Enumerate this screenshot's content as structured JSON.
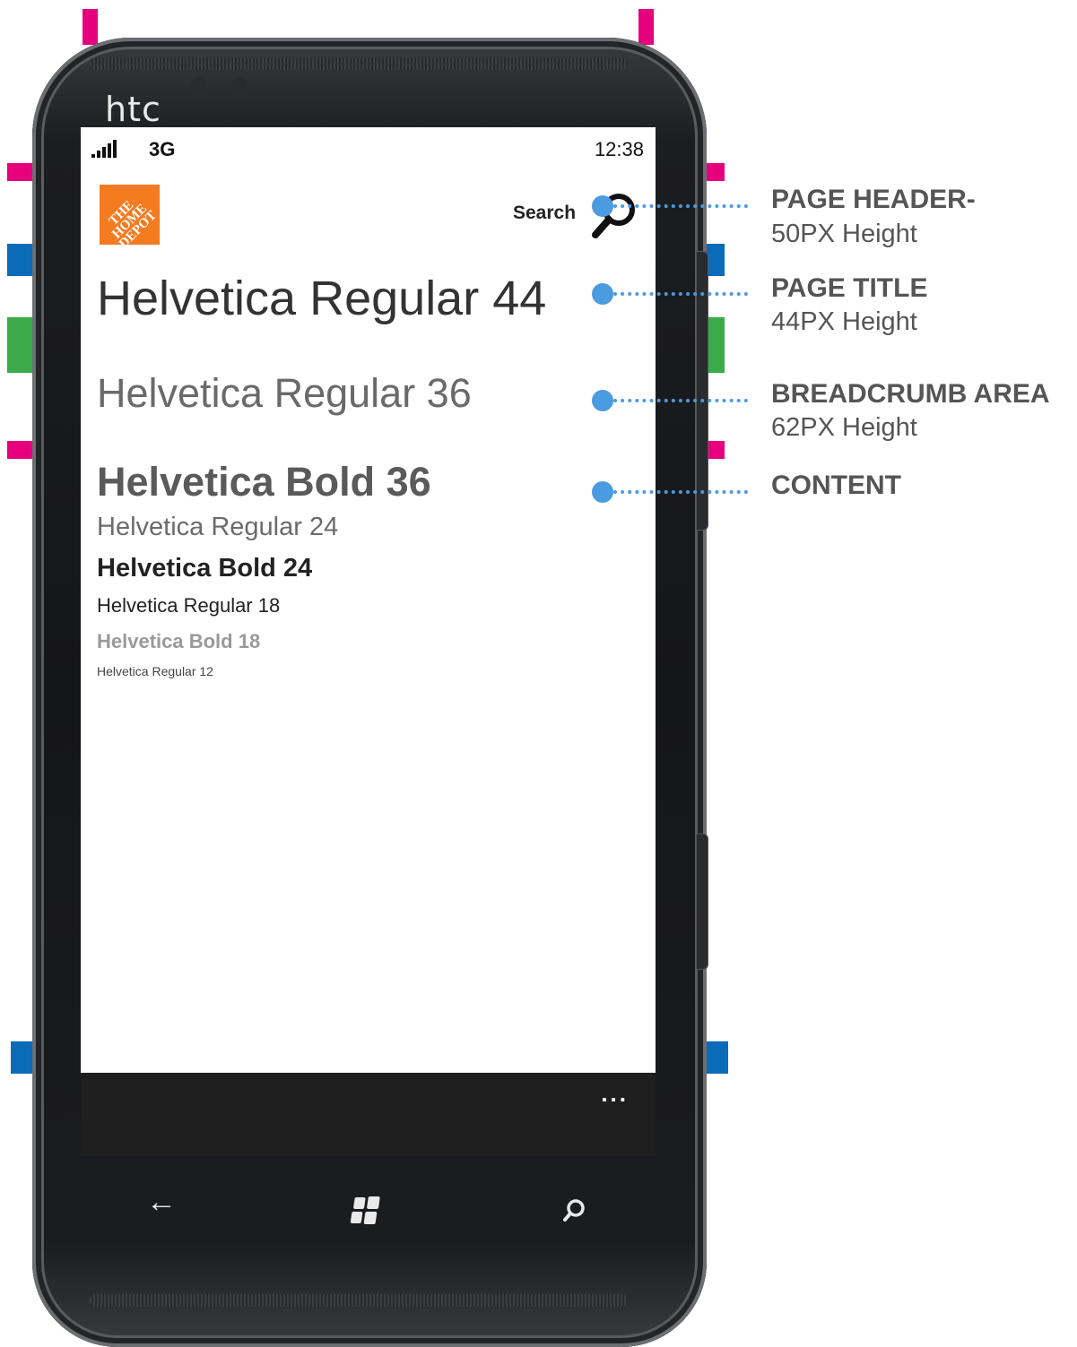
{
  "device": {
    "brand": "htc"
  },
  "status_bar": {
    "network": "3G",
    "time": "12:38"
  },
  "header": {
    "logo_text": "THE HOME DEPOT",
    "search_label": "Search"
  },
  "samples": {
    "regular_44": "Helvetica Regular 44",
    "regular_36": "Helvetica Regular 36",
    "bold_36": "Helvetica Bold 36",
    "regular_24": "Helvetica Regular 24",
    "bold_24": "Helvetica Bold 24",
    "regular_18": "Helvetica Regular 18",
    "bold_18": "Helvetica Bold 18",
    "regular_12": "Helvetica Regular 12"
  },
  "app_bar": {
    "more_label": "..."
  },
  "nav_buttons": {
    "back": "←",
    "search": "⌕"
  },
  "annotations": [
    {
      "title": "PAGE HEADER-",
      "subtitle": "50PX Height"
    },
    {
      "title": "PAGE TITLE",
      "subtitle": "44PX Height"
    },
    {
      "title": "BREADCRUMB AREA",
      "subtitle": "62PX Height"
    },
    {
      "title": "CONTENT",
      "subtitle": ""
    }
  ],
  "colors": {
    "annotation_blue": "#4b9be0",
    "marker_pink": "#e6007e",
    "marker_blue": "#0a6bb8",
    "marker_green": "#3aab48",
    "logo_orange": "#f47b20"
  }
}
